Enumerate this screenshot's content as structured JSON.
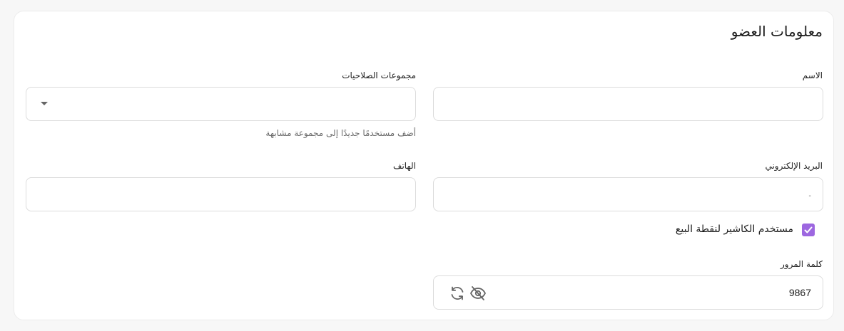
{
  "card": {
    "title": "معلومات العضو"
  },
  "fields": {
    "name": {
      "label": "الاسم",
      "value": ""
    },
    "groups": {
      "label": "مجموعات الصلاحيات",
      "hint": "أضف مستخدمًا جديدًا إلى مجموعة مشابهة",
      "value": ""
    },
    "email": {
      "label": "البريد الإلكتروني",
      "value": "-"
    },
    "phone": {
      "label": "الهاتف",
      "value": ""
    },
    "cashier": {
      "label": "مستخدم الكاشير لنقطة البيع",
      "checked": true
    },
    "password": {
      "label": "كلمة المرور",
      "value": "9867"
    }
  },
  "icons": {
    "dropdown": "chevron-down-icon",
    "checkbox": "check-icon",
    "visibility": "eye-off-icon",
    "regenerate": "refresh-icon"
  },
  "colors": {
    "accent": "#9d67e0",
    "border": "#dcdcdc",
    "background": "#f7f7f7"
  }
}
